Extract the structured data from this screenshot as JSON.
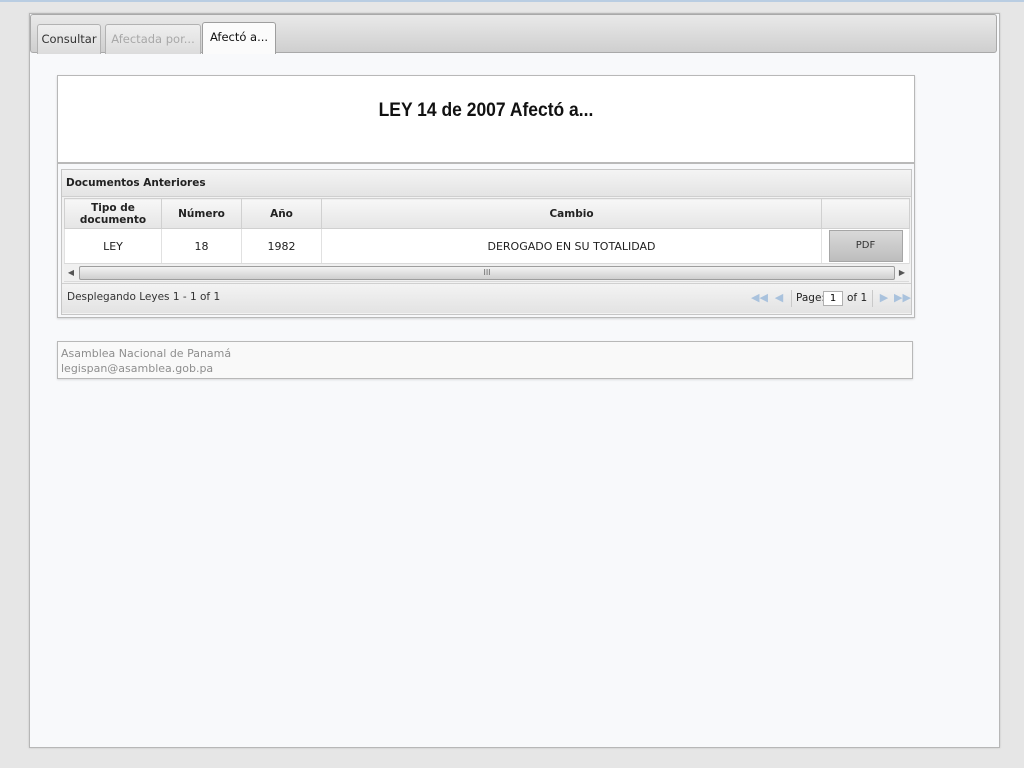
{
  "tabs": [
    {
      "label": "Consultar",
      "state": "normal"
    },
    {
      "label": "Afectada por...",
      "state": "disabled"
    },
    {
      "label": "Afectó a...",
      "state": "active"
    }
  ],
  "main": {
    "title": "LEY 14 de 2007 Afectó a..."
  },
  "grid": {
    "title": "Documentos Anteriores",
    "columns": [
      "Tipo de documento",
      "Número",
      "Año",
      "Cambio",
      ""
    ],
    "rows": [
      {
        "tipo": "LEY",
        "numero": "18",
        "anio": "1982",
        "cambio": "DEROGADO EN SU TOTALIDAD",
        "action": "PDF"
      }
    ],
    "scroll_thumb_label": "III"
  },
  "pager": {
    "info": "Desplegando Leyes 1 - 1 of 1",
    "page_label": "Page:",
    "page_value": "1",
    "of_label": "of 1"
  },
  "footer": {
    "line1": "Asamblea Nacional de Panamá",
    "line2": "legispan@asamblea.gob.pa"
  }
}
